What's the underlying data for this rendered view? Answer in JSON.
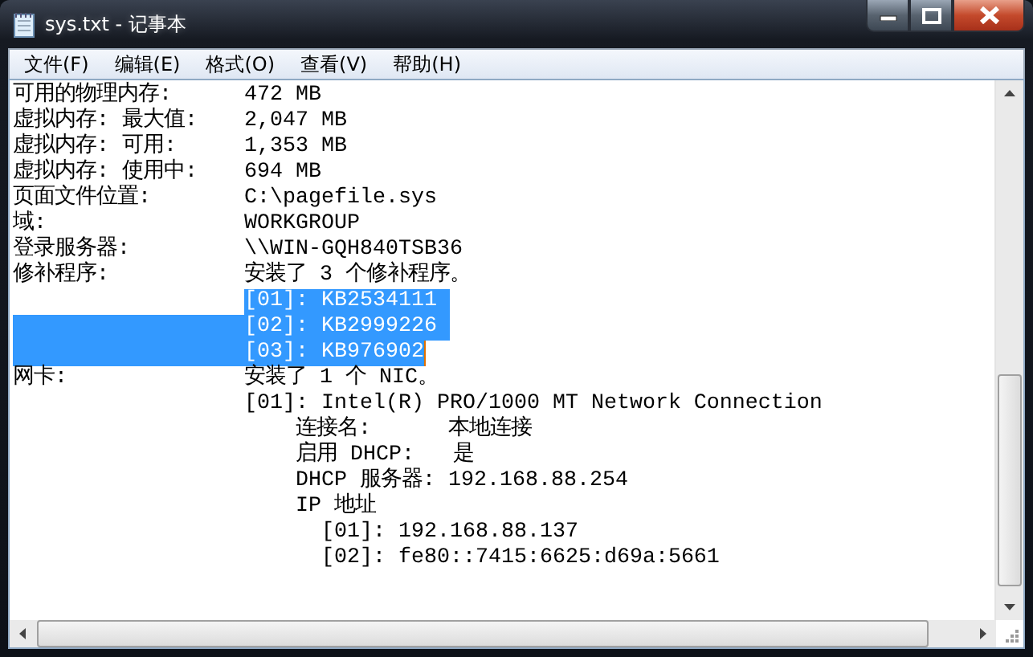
{
  "window": {
    "title": "sys.txt - 记事本"
  },
  "menu": [
    {
      "label": "文件(F)"
    },
    {
      "label": "编辑(E)"
    },
    {
      "label": "格式(O)"
    },
    {
      "label": "查看(V)"
    },
    {
      "label": "帮助(H)"
    }
  ],
  "lines": [
    {
      "label": "可用的物理内存:",
      "value": "472 MB",
      "label_selected": false,
      "value_selected": false,
      "break_selected": false,
      "caret": false
    },
    {
      "label": "虚拟内存: 最大值:",
      "value": "2,047 MB",
      "label_selected": false,
      "value_selected": false,
      "break_selected": false,
      "caret": false
    },
    {
      "label": "虚拟内存: 可用:",
      "value": "1,353 MB",
      "label_selected": false,
      "value_selected": false,
      "break_selected": false,
      "caret": false
    },
    {
      "label": "虚拟内存: 使用中:",
      "value": "694 MB",
      "label_selected": false,
      "value_selected": false,
      "break_selected": false,
      "caret": false
    },
    {
      "label": "页面文件位置:",
      "value": "C:\\pagefile.sys",
      "label_selected": false,
      "value_selected": false,
      "break_selected": false,
      "caret": false
    },
    {
      "label": "域:",
      "value": "WORKGROUP",
      "label_selected": false,
      "value_selected": false,
      "break_selected": false,
      "caret": false
    },
    {
      "label": "登录服务器:",
      "value": "\\\\WIN-GQH840TSB36",
      "label_selected": false,
      "value_selected": false,
      "break_selected": false,
      "caret": false
    },
    {
      "label": "修补程序:",
      "value": "安装了 3 个修补程序。",
      "label_selected": false,
      "value_selected": false,
      "break_selected": false,
      "caret": false
    },
    {
      "value": "[01]: KB2534111",
      "label_selected": false,
      "value_selected": true,
      "break_selected": true,
      "caret": false
    },
    {
      "value": "[02]: KB2999226",
      "label_selected": true,
      "value_selected": true,
      "break_selected": true,
      "caret": false
    },
    {
      "value": "[03]: KB976902",
      "label_selected": true,
      "value_selected": true,
      "break_selected": false,
      "caret": true
    },
    {
      "label": "网卡:",
      "value": "安装了 1 个 NIC。",
      "label_selected": false,
      "value_selected": false,
      "break_selected": false,
      "caret": false
    },
    {
      "value": "[01]: Intel(R) PRO/1000 MT Network Connection",
      "label_selected": false,
      "value_selected": false,
      "break_selected": false,
      "caret": false
    },
    {
      "value": "    连接名:      本地连接",
      "label_selected": false,
      "value_selected": false,
      "break_selected": false,
      "caret": false
    },
    {
      "value": "    启用 DHCP:   是",
      "label_selected": false,
      "value_selected": false,
      "break_selected": false,
      "caret": false
    },
    {
      "value": "    DHCP 服务器: 192.168.88.254",
      "label_selected": false,
      "value_selected": false,
      "break_selected": false,
      "caret": false
    },
    {
      "value": "    IP 地址",
      "label_selected": false,
      "value_selected": false,
      "break_selected": false,
      "caret": false
    },
    {
      "value": "      [01]: 192.168.88.137",
      "label_selected": false,
      "value_selected": false,
      "break_selected": false,
      "caret": false
    },
    {
      "value": "      [02]: fe80::7415:6625:d69a:5661",
      "label_selected": false,
      "value_selected": false,
      "break_selected": false,
      "caret": false
    }
  ]
}
